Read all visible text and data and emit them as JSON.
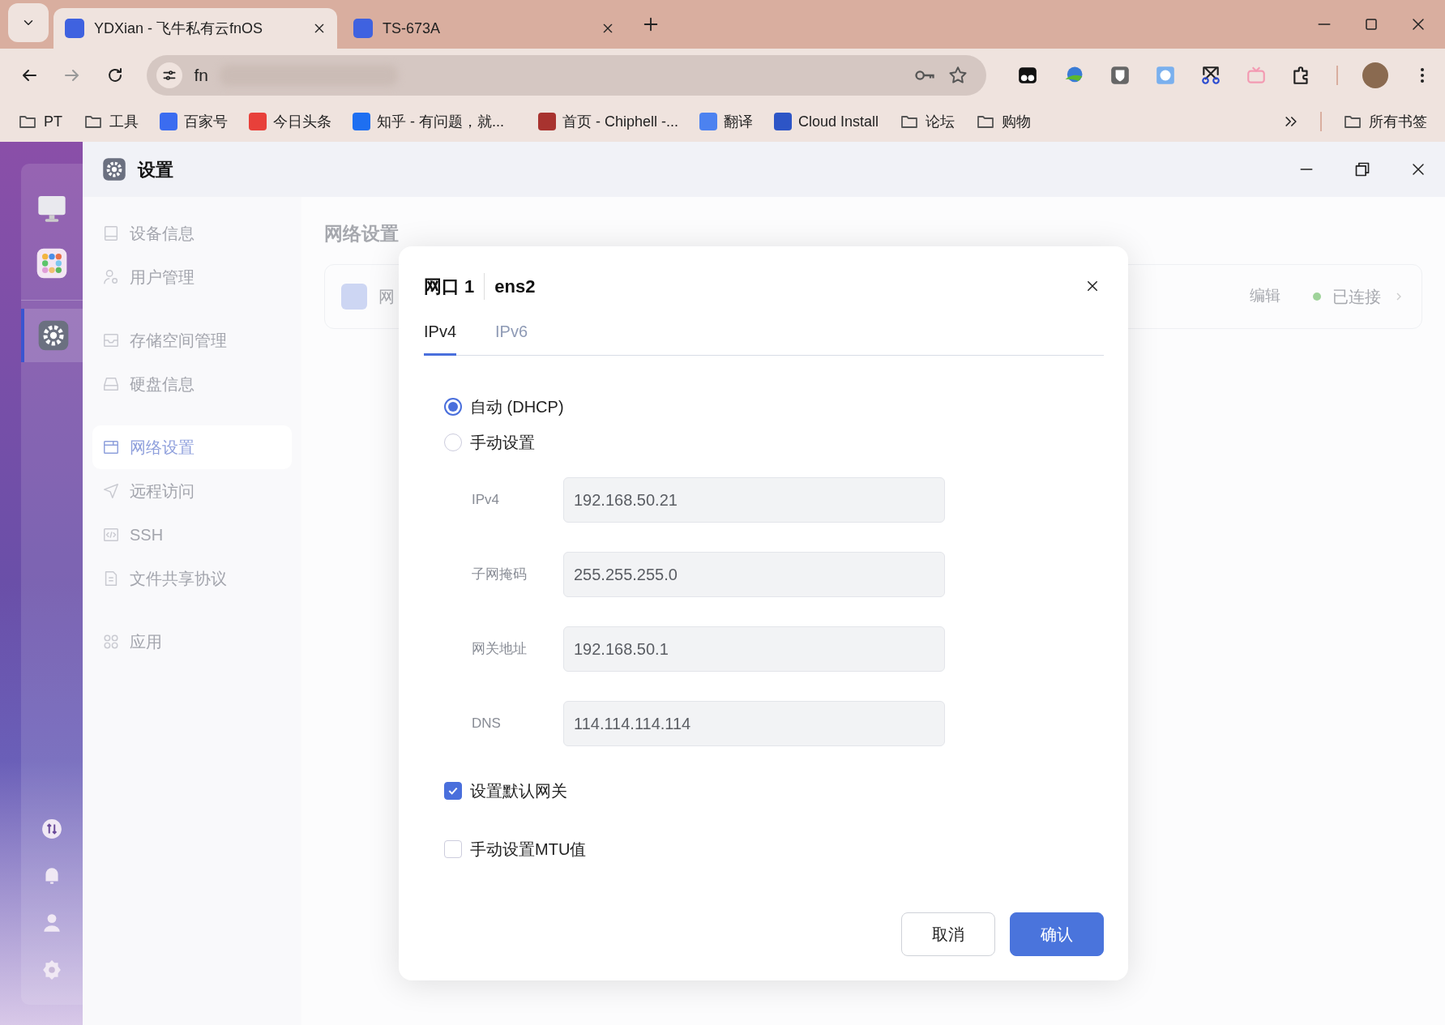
{
  "browser": {
    "tabs": [
      {
        "title": "YDXian - 飞牛私有云fnOS",
        "selected": true
      },
      {
        "title": "TS-673A",
        "selected": false
      }
    ],
    "address": "fn",
    "bookmarks": [
      {
        "label": "PT",
        "kind": "folder"
      },
      {
        "label": "工具",
        "kind": "folder"
      },
      {
        "label": "百家号",
        "kind": "site",
        "color": "#3b6cf0"
      },
      {
        "label": "今日头条",
        "kind": "site",
        "color": "#e8403a"
      },
      {
        "label": "知乎 - 有问题，就...",
        "kind": "site",
        "color": "#1e6ff1"
      },
      {
        "label": "首页 - Chiphell -...",
        "kind": "site",
        "color": "#a8332f"
      },
      {
        "label": "翻译",
        "kind": "site",
        "color": "#4c82f0"
      },
      {
        "label": "Cloud Install",
        "kind": "site",
        "color": "#2d55c6"
      },
      {
        "label": "论坛",
        "kind": "folder"
      },
      {
        "label": "购物",
        "kind": "folder"
      }
    ],
    "all_bookmarks": "所有书签"
  },
  "dock": [
    {
      "selected": false
    },
    {
      "selected": false
    },
    {
      "selected": true
    }
  ],
  "window": {
    "title": "设置"
  },
  "sidebar": {
    "groups": [
      [
        {
          "label": "设备信息",
          "selected": false
        },
        {
          "label": "用户管理",
          "selected": false
        }
      ],
      [
        {
          "label": "存储空间管理",
          "selected": false
        },
        {
          "label": "硬盘信息",
          "selected": false
        }
      ],
      [
        {
          "label": "网络设置",
          "selected": true
        },
        {
          "label": "远程访问",
          "selected": false
        },
        {
          "label": "SSH",
          "selected": false
        },
        {
          "label": "文件共享协议",
          "selected": false
        }
      ],
      [
        {
          "label": "应用",
          "selected": false
        }
      ]
    ]
  },
  "content": {
    "heading": "网络设置",
    "card": {
      "name": "网",
      "edit": "编辑",
      "status": "已连接",
      "connected": true
    }
  },
  "dialog": {
    "title": "网口 1",
    "subtitle": "ens2",
    "tabs": [
      {
        "label": "IPv4",
        "selected": true
      },
      {
        "label": "IPv6",
        "selected": false
      }
    ],
    "radios": [
      {
        "label": "自动 (DHCP)",
        "selected": true
      },
      {
        "label": "手动设置",
        "selected": false
      }
    ],
    "fields": [
      {
        "label": "IPv4",
        "value": "192.168.50.21",
        "disabled": true
      },
      {
        "label": "子网掩码",
        "value": "255.255.255.0",
        "disabled": true
      },
      {
        "label": "网关地址",
        "value": "192.168.50.1",
        "disabled": true
      },
      {
        "label": "DNS",
        "value": "114.114.114.114",
        "disabled": true
      }
    ],
    "checkboxes": [
      {
        "label": "设置默认网关",
        "checked": true
      },
      {
        "label": "手动设置MTU值",
        "checked": false
      }
    ],
    "buttons": [
      {
        "label": "取消",
        "kind": "secondary"
      },
      {
        "label": "确认",
        "kind": "primary"
      }
    ]
  }
}
